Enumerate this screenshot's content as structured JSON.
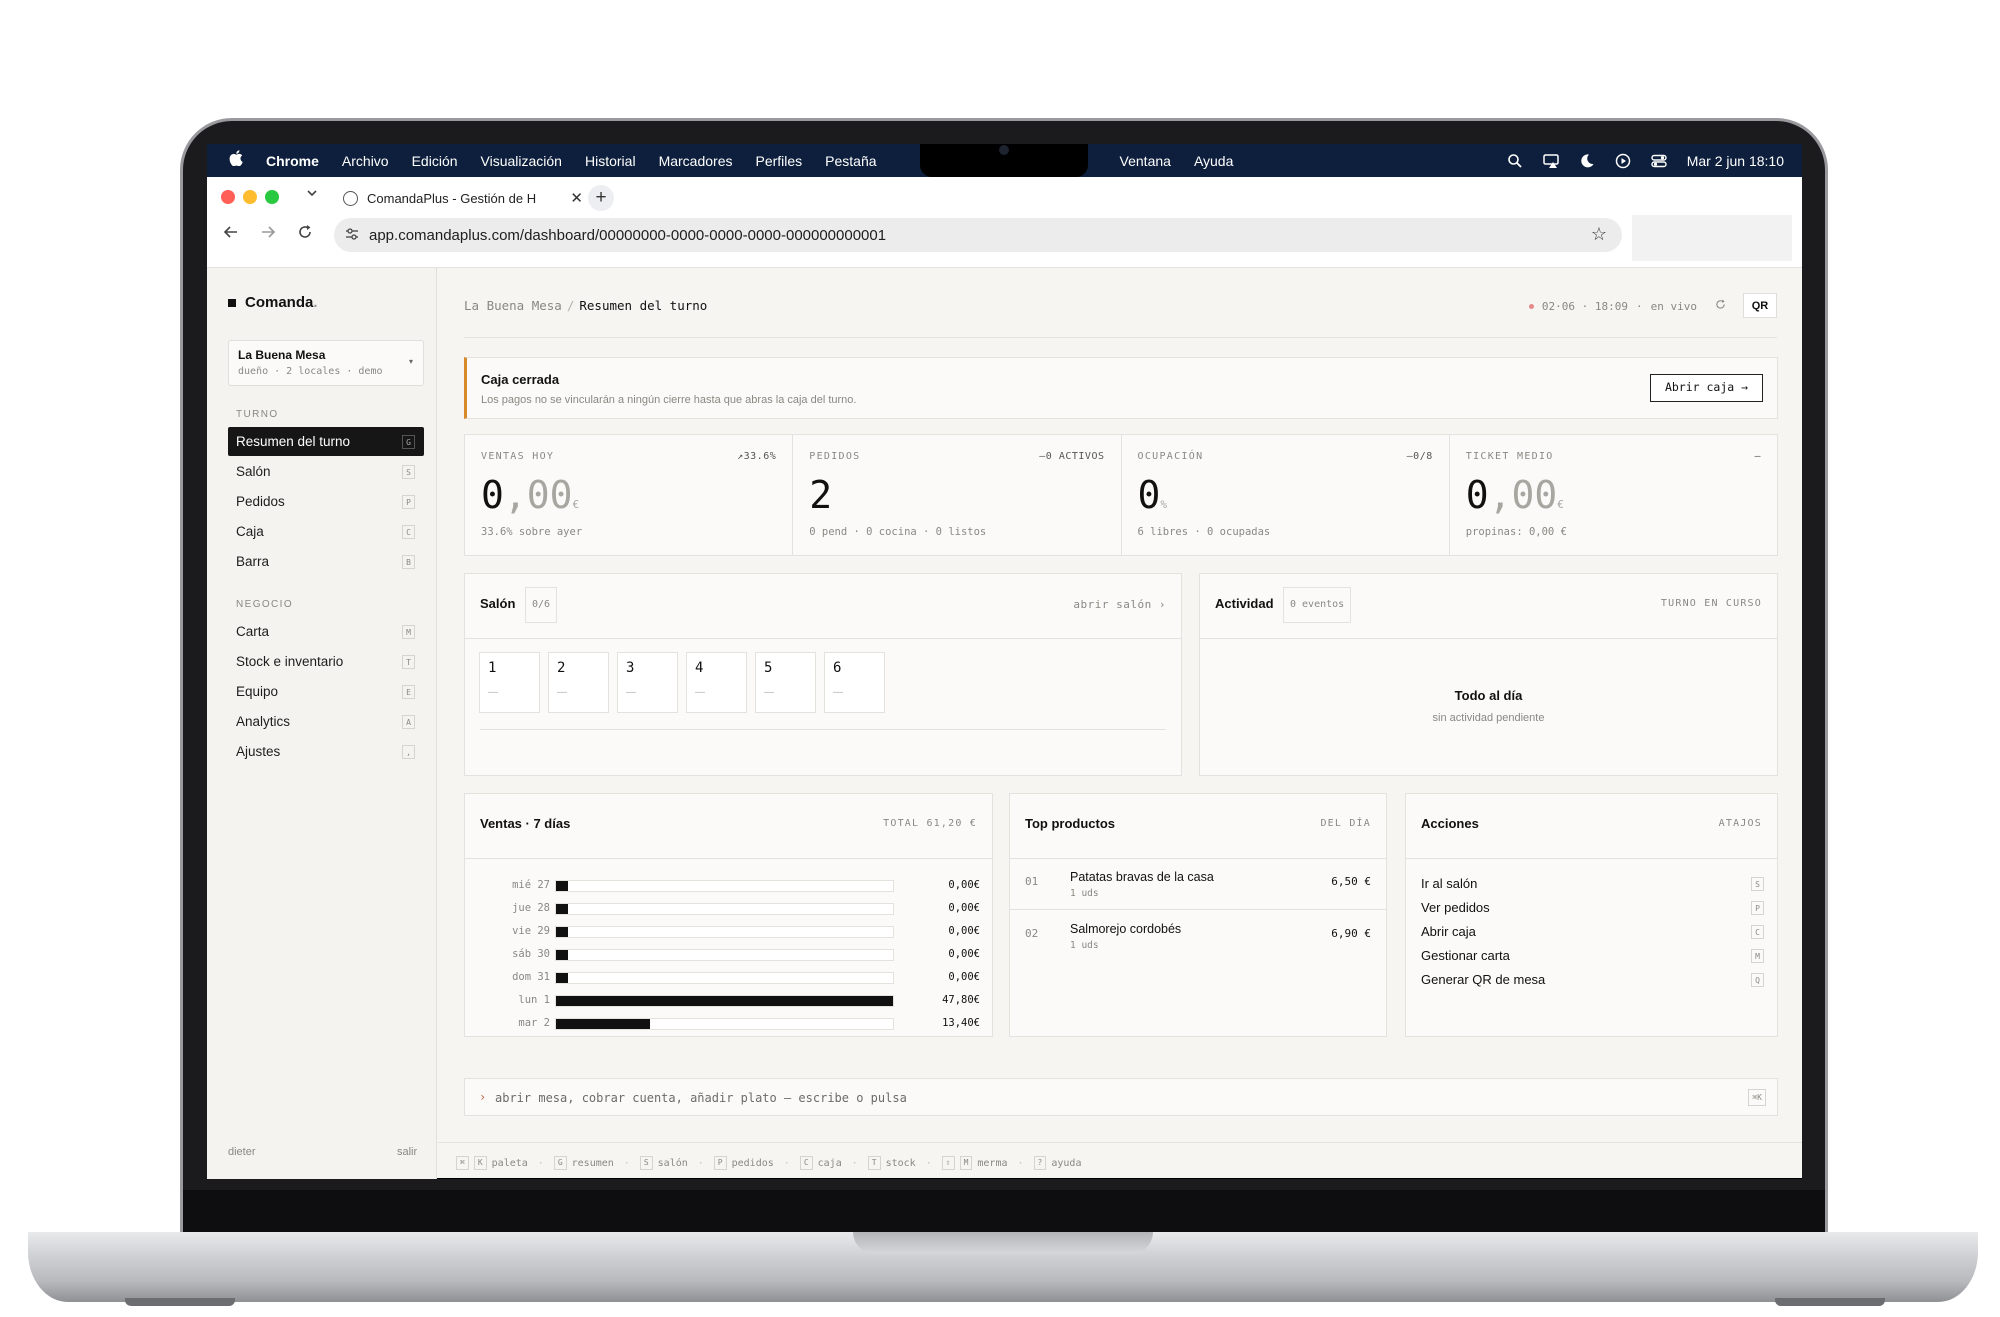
{
  "menubar": {
    "app": "Chrome",
    "items": [
      "Archivo",
      "Edición",
      "Visualización",
      "Historial",
      "Marcadores",
      "Perfiles",
      "Pestaña"
    ],
    "items_right": [
      "Ventana",
      "Ayuda"
    ],
    "datetime": "Mar 2 jun 18:10",
    "icons": [
      "search-icon",
      "screen-mirror-icon",
      "moon-icon",
      "play-icon",
      "control-center-icon"
    ]
  },
  "browser": {
    "tab_title": "ComandaPlus - Gestión de H",
    "url": "app.comandaplus.com/dashboard/00000000-0000-0000-0000-000000000001",
    "colors": {
      "close": "#ff5f57",
      "minimize": "#febc2e",
      "zoom": "#28c840"
    }
  },
  "sidebar": {
    "brand": "Comanda",
    "brand_dot": ".",
    "org": {
      "name": "La Buena Mesa",
      "meta": "dueño · 2 locales · demo"
    },
    "sections": [
      {
        "label": "TURNO",
        "items": [
          {
            "label": "Resumen del turno",
            "key": "G",
            "active": true
          },
          {
            "label": "Salón",
            "key": "S"
          },
          {
            "label": "Pedidos",
            "key": "P"
          },
          {
            "label": "Caja",
            "key": "C"
          },
          {
            "label": "Barra",
            "key": "B"
          }
        ]
      },
      {
        "label": "NEGOCIO",
        "items": [
          {
            "label": "Carta",
            "key": "M"
          },
          {
            "label": "Stock e inventario",
            "key": "T"
          },
          {
            "label": "Equipo",
            "key": "E"
          },
          {
            "label": "Analytics",
            "key": "A"
          },
          {
            "label": "Ajustes",
            "key": ","
          }
        ]
      }
    ],
    "user": "dieter",
    "logout": "salir"
  },
  "header": {
    "breadcrumb_root": "La Buena Mesa",
    "breadcrumb_sep": "/",
    "breadcrumb_current": "Resumen del turno",
    "date": "02·06 · 18:09",
    "live": "en vivo",
    "qr": "QR"
  },
  "alert": {
    "title": "Caja cerrada",
    "desc": "Los pagos no se vincularán a ningún cierre hasta que abras la caja del turno.",
    "button": "Abrir caja →",
    "accent": "#d88a2a"
  },
  "kpis": [
    {
      "label": "VENTAS HOY",
      "tag": "↗33.6%",
      "int": "0",
      "dec": ",00",
      "unit": "€",
      "sub": "33.6% sobre ayer"
    },
    {
      "label": "PEDIDOS",
      "tag": "—0 ACTIVOS",
      "int": "2",
      "dec": "",
      "unit": "",
      "sub": "0 pend · 0 cocina · 0 listos"
    },
    {
      "label": "OCUPACIÓN",
      "tag": "—0/8",
      "int": "0",
      "dec": "",
      "unit": "%",
      "sub": "6 libres · 0 ocupadas"
    },
    {
      "label": "TICKET MEDIO",
      "tag": "—",
      "int": "0",
      "dec": ",00",
      "unit": "€",
      "sub": "propinas: 0,00 €"
    }
  ],
  "salon": {
    "title": "Salón",
    "count": "0/6",
    "link": "abrir salón ›",
    "tables": [
      {
        "num": "1",
        "state": "—"
      },
      {
        "num": "2",
        "state": "—"
      },
      {
        "num": "3",
        "state": "—"
      },
      {
        "num": "4",
        "state": "—"
      },
      {
        "num": "5",
        "state": "—"
      },
      {
        "num": "6",
        "state": "—"
      }
    ]
  },
  "activity": {
    "title": "Actividad",
    "count": "0 eventos",
    "right": "TURNO EN CURSO",
    "empty_title": "Todo al día",
    "empty_sub": "sin actividad pendiente"
  },
  "sales": {
    "title": "Ventas · 7 días",
    "total": "TOTAL 61,20 €",
    "rows": [
      {
        "day": "mié 27",
        "value": "0,00€",
        "frac": 0.0
      },
      {
        "day": "jue 28",
        "value": "0,00€",
        "frac": 0.0
      },
      {
        "day": "vie 29",
        "value": "0,00€",
        "frac": 0.0
      },
      {
        "day": "sáb 30",
        "value": "0,00€",
        "frac": 0.0
      },
      {
        "day": "dom 31",
        "value": "0,00€",
        "frac": 0.0
      },
      {
        "day": "lun 1",
        "value": "47,80€",
        "frac": 1.0
      },
      {
        "day": "mar 2",
        "value": "13,40€",
        "frac": 0.28
      }
    ]
  },
  "top_products": {
    "title": "Top productos",
    "right": "DEL DÍA",
    "items": [
      {
        "idx": "01",
        "name": "Patatas bravas de la casa",
        "units": "1 uds",
        "price": "6,50 €"
      },
      {
        "idx": "02",
        "name": "Salmorejo cordobés",
        "units": "1 uds",
        "price": "6,90 €"
      }
    ]
  },
  "actions": {
    "title": "Acciones",
    "right": "ATAJOS",
    "items": [
      {
        "label": "Ir al salón",
        "key": "S"
      },
      {
        "label": "Ver pedidos",
        "key": "P"
      },
      {
        "label": "Abrir caja",
        "key": "C"
      },
      {
        "label": "Gestionar carta",
        "key": "M"
      },
      {
        "label": "Generar QR de mesa",
        "key": "Q"
      }
    ]
  },
  "command": {
    "caret": "›",
    "placeholder": "abrir mesa, cobrar cuenta, añadir plato — escribe o pulsa",
    "shortcut": "⌘K"
  },
  "footer": {
    "items": [
      {
        "key": "⌘",
        "key2": "K",
        "label": "paleta"
      },
      {
        "key": "G",
        "label": "resumen"
      },
      {
        "key": "S",
        "label": "salón"
      },
      {
        "key": "P",
        "label": "pedidos"
      },
      {
        "key": "C",
        "label": "caja"
      },
      {
        "key": "T",
        "label": "stock"
      },
      {
        "key": "⇧",
        "key2": "M",
        "label": "merma"
      },
      {
        "key": "?",
        "label": "ayuda"
      }
    ]
  }
}
